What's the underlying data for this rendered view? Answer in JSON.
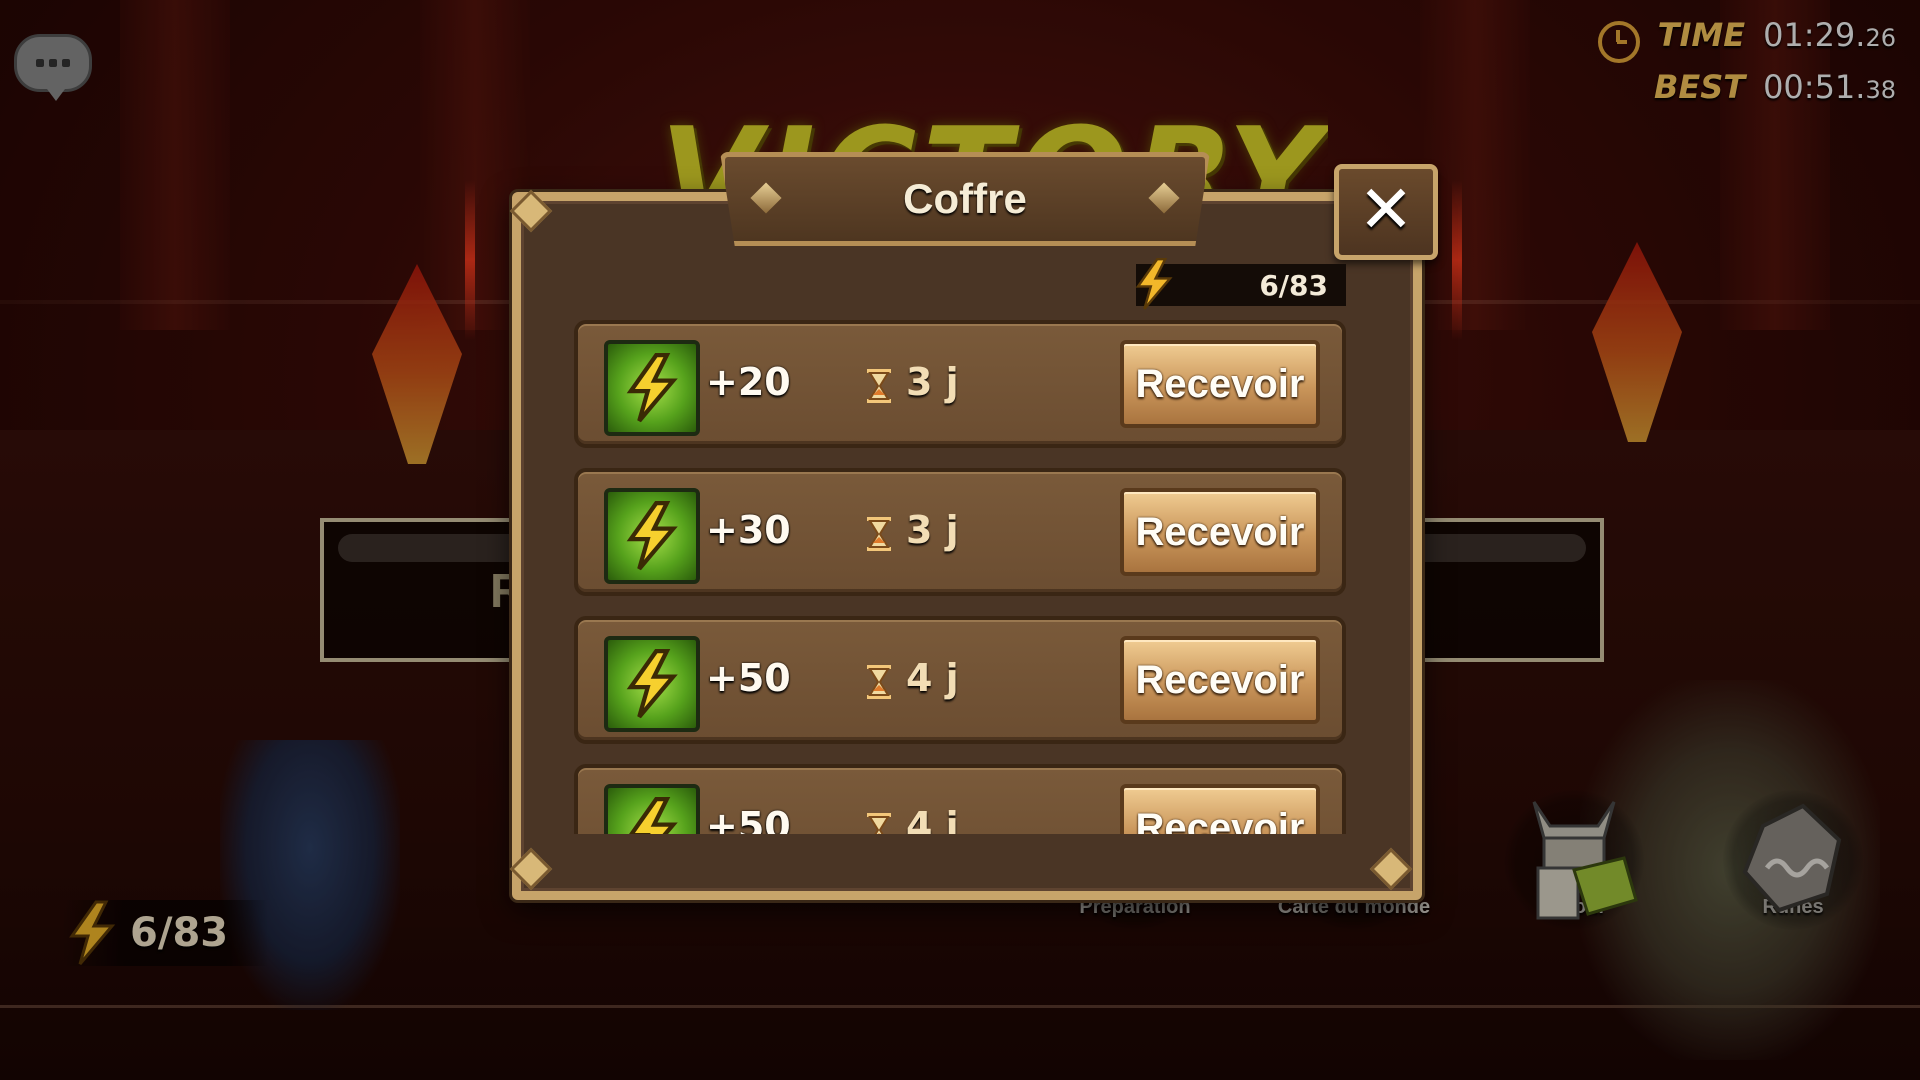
{
  "hud": {
    "time_label": "TIME",
    "time_main": "01:29.",
    "time_frac": "26",
    "best_label": "BEST",
    "best_main": "00:51.",
    "best_frac": "38"
  },
  "victory_banner": "VICTORY",
  "background_panel_letter": "R",
  "energy": "6/83",
  "popup": {
    "title": "Coffre",
    "energy": "6/83",
    "rows": [
      {
        "amount": "+20",
        "time": "3 j",
        "button": "Recevoir"
      },
      {
        "amount": "+30",
        "time": "3 j",
        "button": "Recevoir"
      },
      {
        "amount": "+50",
        "time": "4 j",
        "button": "Recevoir"
      },
      {
        "amount": "+50",
        "time": "4 j",
        "button": "Recevoir"
      }
    ]
  },
  "bottom_menu": [
    {
      "label": "Préparation",
      "icon": "preparation-icon"
    },
    {
      "label": "Carte du monde",
      "icon": "world-map-icon"
    },
    {
      "label": "Retour",
      "icon": "return-icon"
    },
    {
      "label": "Runes",
      "icon": "runes-icon"
    }
  ],
  "colors": {
    "gold": "#f4c35a",
    "popup_frame": "#c7a46a",
    "button": "#c9955a",
    "reward_icon": "#56a21c"
  }
}
